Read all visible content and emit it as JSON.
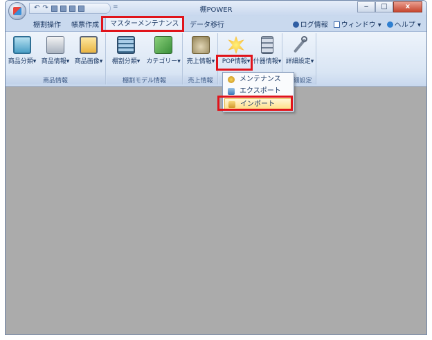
{
  "window": {
    "title": "棚POWER",
    "minimize": "‒",
    "maximize": "□",
    "close": "x"
  },
  "qat": {
    "more": "="
  },
  "tabs": [
    {
      "label": "棚割操作"
    },
    {
      "label": "帳票作成"
    },
    {
      "label": "マスターメンテナンス"
    },
    {
      "label": "データ移行"
    }
  ],
  "right_menus": {
    "log": "ログ情報",
    "window": "ウィンドウ",
    "help": "ヘルプ"
  },
  "ribbon": {
    "groups": [
      {
        "label": "商品情報",
        "buttons": [
          "商品分類",
          "商品情報",
          "商品画像"
        ]
      },
      {
        "label": "棚割モデル情報",
        "buttons": [
          "棚割分類",
          "カテゴリー"
        ]
      },
      {
        "label": "売上情報",
        "buttons": [
          "売上情報"
        ]
      },
      {
        "label": "",
        "buttons": [
          "POP情報",
          "什器情報"
        ]
      },
      {
        "label": "詳細設定",
        "buttons": [
          "詳細設定"
        ]
      }
    ]
  },
  "dropdown": {
    "items": [
      "メンテナンス",
      "エクスポート",
      "インポート"
    ]
  },
  "colors": {
    "highlight": "#e0141b",
    "workspace": "#ababab"
  }
}
